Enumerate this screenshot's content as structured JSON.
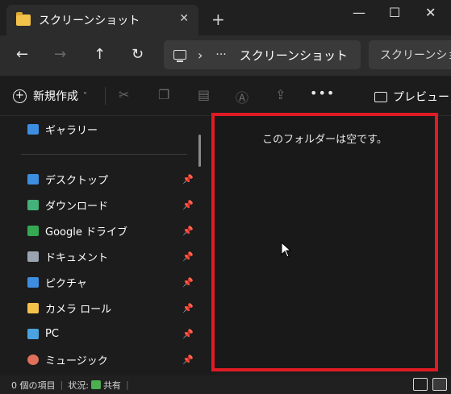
{
  "window": {
    "tab_title": "スクリーンショット",
    "tab_close": "✕",
    "new_tab": "+",
    "minimize": "—",
    "maximize": "☐",
    "close": "✕"
  },
  "nav": {
    "back": "←",
    "forward": "→",
    "up": "↑",
    "refresh": "↻",
    "breadcrumb_sep": "›",
    "breadcrumb_more": "···",
    "breadcrumb_current": "スクリーンショット",
    "search_placeholder": "スクリーンショッ"
  },
  "toolbar": {
    "new_label": "新規作成",
    "new_chevron": "˅",
    "cut_icon": "✂",
    "copy_icon": "❐",
    "paste_icon": "▤",
    "rename_icon": "Ⓐ",
    "share_icon": "⇪",
    "more": "•••",
    "preview_label": "プレビュー"
  },
  "sidebar": {
    "gallery": {
      "label": "ギャラリー",
      "color": "#3d8ee0"
    },
    "items": [
      {
        "label": "デスクトップ",
        "color": "#3d8ee0"
      },
      {
        "label": "ダウンロード",
        "color": "#44b07a"
      },
      {
        "label": "Google ドライブ",
        "color": "#34a853"
      },
      {
        "label": "ドキュメント",
        "color": "#9aa4b0"
      },
      {
        "label": "ピクチャ",
        "color": "#3d8ee0"
      },
      {
        "label": "カメラ ロール",
        "color": "#f3c24a"
      },
      {
        "label": "PC",
        "color": "#4aa3e0"
      },
      {
        "label": "ミュージック",
        "color": "#e0705a"
      }
    ],
    "pin_icon": "📌"
  },
  "content": {
    "empty_message": "このフォルダーは空です。"
  },
  "status": {
    "item_count": "0 個の項目",
    "state_label": "状況:",
    "state_value": "共有"
  }
}
